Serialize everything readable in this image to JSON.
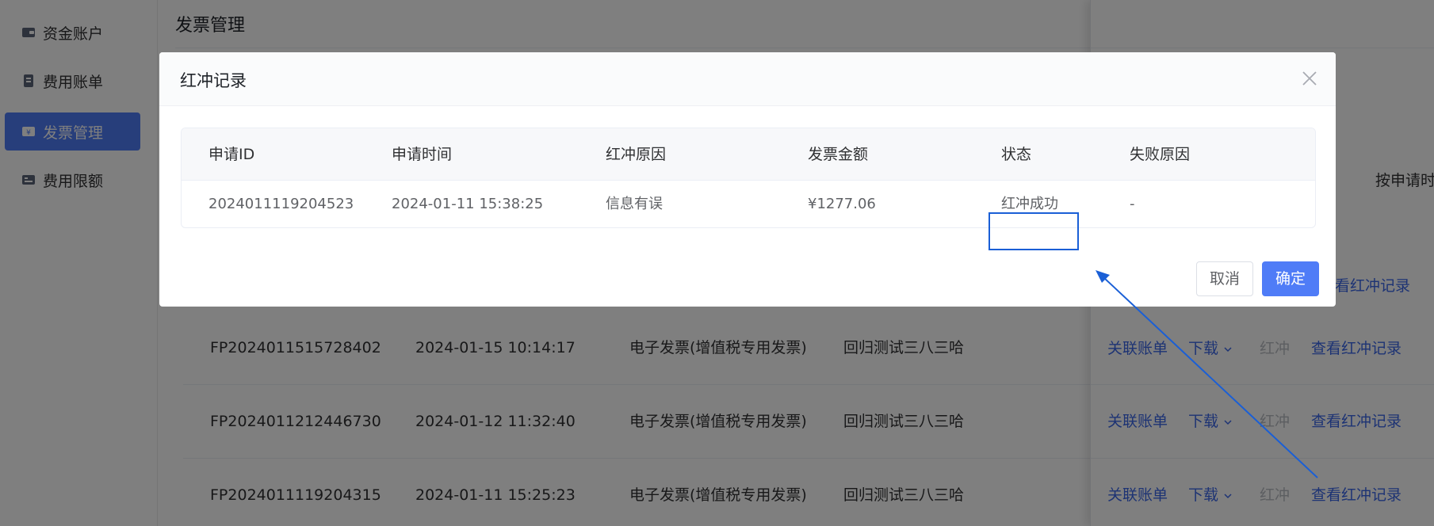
{
  "sidebar": {
    "items": [
      {
        "label": "资金账户",
        "icon": "wallet-icon",
        "active": false
      },
      {
        "label": "费用账单",
        "icon": "bill-icon",
        "active": false
      },
      {
        "label": "发票管理",
        "icon": "invoice-icon",
        "active": true
      },
      {
        "label": "费用限额",
        "icon": "limit-icon",
        "active": false
      }
    ]
  },
  "page": {
    "title": "发票管理",
    "filter_text": "按申请时"
  },
  "background_rows": [
    {
      "id": "FP2024011515728402",
      "time": "2024-01-15 10:14:17",
      "type": "电子发票(增值税专用发票)",
      "title": "回归测试三八三哈"
    },
    {
      "id": "FP2024011212446730",
      "time": "2024-01-12 11:32:40",
      "type": "电子发票(增值税专用发票)",
      "title": "回归测试三八三哈"
    },
    {
      "id": "FP2024011119204315",
      "time": "2024-01-11 15:25:23",
      "type": "电子发票(增值税专用发票)",
      "title": "回归测试三八三哈"
    }
  ],
  "row_actions": {
    "link_bill": "关联账单",
    "download": "下载",
    "red_flush": "红冲",
    "view_red_records": "查看红冲记录"
  },
  "dialog": {
    "title": "红冲记录",
    "columns": [
      "申请ID",
      "申请时间",
      "红冲原因",
      "发票金额",
      "状态",
      "失败原因"
    ],
    "rows": [
      {
        "id": "2024011119204523",
        "time": "2024-01-11 15:38:25",
        "reason": "信息有误",
        "amount": "¥1277.06",
        "status": "红冲成功",
        "fail_reason": "-"
      }
    ],
    "cancel_label": "取消",
    "ok_label": "确定"
  },
  "colors": {
    "primary": "#4f7cf7",
    "link": "#3a66e8",
    "annotation": "#1a5fd6"
  }
}
